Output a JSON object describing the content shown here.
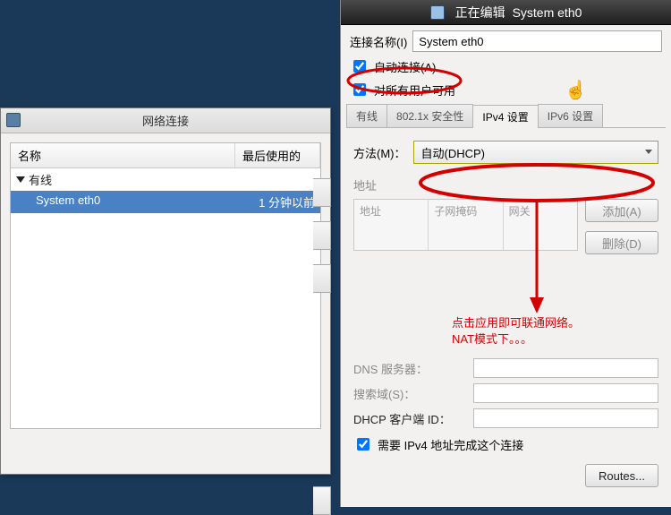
{
  "left_window": {
    "title": "网络连接",
    "columns": {
      "name": "名称",
      "last_used": "最后使用的"
    },
    "group": "有线",
    "connection": {
      "name": "System eth0",
      "last_used": "1 分钟以前"
    }
  },
  "right_window": {
    "title_prefix": "正在编辑",
    "title_name": "System eth0",
    "conn_name_label": "连接名称(I)",
    "conn_name_value": "System eth0",
    "auto_connect": "自动连接(A)",
    "all_users": "对所有用户可用",
    "tabs": [
      "有线",
      "802.1x 安全性",
      "IPv4 设置",
      "IPv6 设置"
    ],
    "active_tab_index": 2,
    "ipv4": {
      "method_label": "方法(M)：",
      "method_value": "自动(DHCP)",
      "address_group": "地址",
      "cols": {
        "addr": "地址",
        "mask": "子网掩码",
        "gw": "网关"
      },
      "add_btn": "添加(A)",
      "del_btn": "删除(D)",
      "dns_label": "DNS 服务器：",
      "search_label": "搜索域(S)：",
      "dhcp_client_label": "DHCP 客户端 ID：",
      "require_ipv4": "需要 IPv4 地址完成这个连接",
      "routes_btn": "Routes..."
    }
  },
  "annotation": {
    "line1": "点击应用即可联通网络。",
    "line2": "NAT模式下。。。"
  }
}
